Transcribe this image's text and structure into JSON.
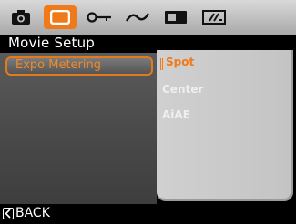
{
  "mode_tabs": [
    {
      "icon": "camera-icon",
      "active": false
    },
    {
      "icon": "movie-icon",
      "active": true
    },
    {
      "icon": "key-icon",
      "active": false
    },
    {
      "icon": "wave-icon",
      "active": false
    },
    {
      "icon": "display-icon",
      "active": false
    },
    {
      "icon": "settings-card-icon",
      "active": false
    }
  ],
  "header": {
    "title": "Movie Setup"
  },
  "menu": {
    "items": [
      {
        "label": "Expo Metering",
        "selected": true
      }
    ]
  },
  "options": {
    "items": [
      {
        "label": "Spot",
        "selected": true
      },
      {
        "label": "Center",
        "selected": false
      },
      {
        "label": "AiAE",
        "selected": false
      }
    ]
  },
  "footer": {
    "back_label": "BACK"
  },
  "colors": {
    "accent": "#f07a1a",
    "panel": "#c8c8c8",
    "topbar": "#c4c4c4"
  }
}
